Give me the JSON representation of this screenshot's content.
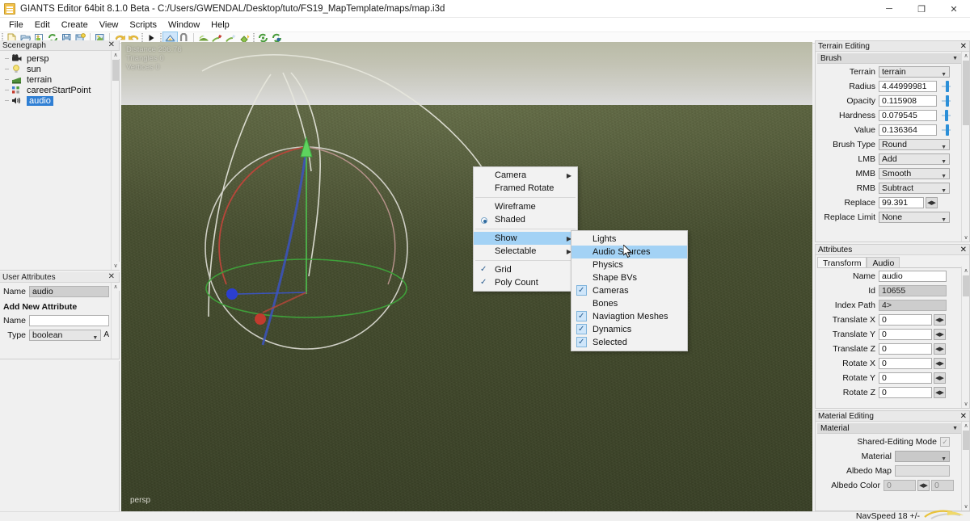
{
  "window": {
    "title": "GIANTS Editor 64bit 8.1.0 Beta - C:/Users/GWENDAL/Desktop/tuto/FS19_MapTemplate/maps/map.i3d",
    "app_icon": "app-icon",
    "minimize": "─",
    "maximize": "❐",
    "close": "✕"
  },
  "menubar": {
    "items": [
      "File",
      "Edit",
      "Create",
      "View",
      "Scripts",
      "Window",
      "Help"
    ]
  },
  "toolbar": {
    "groups": [
      {
        "icons": [
          "new-file-icon",
          "open-file-icon",
          "import-icon",
          "reload-icon",
          "save-icon",
          "save-as-icon"
        ]
      },
      {
        "icons": [
          "undo-history-icon"
        ]
      },
      {
        "icons": [
          "undo-icon",
          "redo-icon"
        ]
      },
      {
        "icons": [
          "play-icon"
        ]
      },
      {
        "icons": [
          "terrain-edit-icon",
          "snap-icon"
        ]
      },
      {
        "icons": [
          "paint-layer-icon",
          "foliage-paint-icon",
          "foliage-erase-icon",
          "foliage-fill-icon"
        ]
      },
      {
        "icons": [
          "refresh-shaders-icon",
          "reload-scene-icon"
        ]
      }
    ]
  },
  "scenegraph": {
    "title": "Scenegraph",
    "close": "✕",
    "items": [
      {
        "label": "persp",
        "icon": "camera-icon",
        "selected": false
      },
      {
        "label": "sun",
        "icon": "light-bulb-icon",
        "selected": false
      },
      {
        "label": "terrain",
        "icon": "terrain-icon",
        "selected": false
      },
      {
        "label": "careerStartPoint",
        "icon": "transform-group-icon",
        "selected": false
      },
      {
        "label": "audio",
        "icon": "audio-source-icon",
        "selected": true
      }
    ],
    "scroll_up": "∧",
    "scroll_down": "∨"
  },
  "user_attributes": {
    "title": "User Attributes",
    "close": "✕",
    "name_label": "Name",
    "name_value": "audio",
    "add_section_title": "Add New Attribute",
    "new_name_label": "Name",
    "new_name_value": "",
    "type_label": "Type",
    "type_value": "boolean",
    "add_button": "A",
    "scroll_up": "∧"
  },
  "viewport": {
    "stats": [
      "Distance 296.76",
      "Triangles 0",
      "Vertices 0"
    ],
    "view_name": "persp",
    "gizmo": {
      "x_axis_color": "#c23b2e",
      "y_axis_color": "#3fc23f",
      "z_axis_color": "#2b3fd0",
      "ring_color": "#d6d6cc"
    }
  },
  "context_menu": {
    "items": [
      {
        "label": "Camera",
        "submenu": true,
        "check": "none"
      },
      {
        "label": "Framed Rotate",
        "submenu": false,
        "check": "none"
      },
      {
        "separator_after": true
      },
      {
        "label": "Wireframe",
        "submenu": false,
        "check": "none"
      },
      {
        "label": "Shaded",
        "submenu": false,
        "check": "radio"
      },
      {
        "separator_after": true
      },
      {
        "label": "Show",
        "submenu": true,
        "check": "none",
        "highlighted": true
      },
      {
        "label": "Selectable",
        "submenu": true,
        "check": "none"
      },
      {
        "separator_after": true
      },
      {
        "label": "Grid",
        "submenu": false,
        "check": "checked"
      },
      {
        "label": "Poly Count",
        "submenu": false,
        "check": "checked"
      }
    ]
  },
  "show_submenu": {
    "items": [
      {
        "label": "Lights",
        "check": "none",
        "highlighted": false
      },
      {
        "label": "Audio Sources",
        "check": "none",
        "highlighted": true
      },
      {
        "label": "Physics",
        "check": "none",
        "highlighted": false
      },
      {
        "label": "Shape BVs",
        "check": "none",
        "highlighted": false
      },
      {
        "label": "Cameras",
        "check": "checked",
        "highlighted": false
      },
      {
        "label": "Bones",
        "check": "none",
        "highlighted": false
      },
      {
        "label": "Naviagtion Meshes",
        "check": "checked",
        "highlighted": false
      },
      {
        "label": "Dynamics",
        "check": "checked",
        "highlighted": false
      },
      {
        "label": "Selected",
        "check": "checked",
        "highlighted": false
      }
    ],
    "check_glyph": "✓"
  },
  "terrain_editing": {
    "title": "Terrain Editing",
    "close": "✕",
    "section": "Brush",
    "section_tri": "▼",
    "rows": [
      {
        "label": "Terrain",
        "value": "terrain",
        "kind": "combo"
      },
      {
        "label": "Radius",
        "value": "4.44999981",
        "kind": "input",
        "slider": 0.72
      },
      {
        "label": "Opacity",
        "value": "0.115908",
        "kind": "input",
        "slider": 0.62
      },
      {
        "label": "Hardness",
        "value": "0.079545",
        "kind": "input",
        "slider": 0.66
      },
      {
        "label": "Value",
        "value": "0.136364",
        "kind": "input",
        "slider": 0.55
      },
      {
        "label": "Brush Type",
        "value": "Round",
        "kind": "combo"
      },
      {
        "label": "LMB",
        "value": "Add",
        "kind": "combo"
      },
      {
        "label": "MMB",
        "value": "Smooth",
        "kind": "combo"
      },
      {
        "label": "RMB",
        "value": "Subtract",
        "kind": "combo"
      },
      {
        "label": "Replace",
        "value": "99.391",
        "kind": "spin"
      },
      {
        "label": "Replace Limit",
        "value": "None",
        "kind": "combo"
      }
    ],
    "scroll_up": "∧",
    "scroll_down": "∨"
  },
  "attributes": {
    "title": "Attributes",
    "close": "✕",
    "tabs": [
      {
        "label": "Transform",
        "active": true
      },
      {
        "label": "Audio",
        "active": false
      }
    ],
    "rows": [
      {
        "label": "Name",
        "value": "audio",
        "kind": "input"
      },
      {
        "label": "Id",
        "value": "10655",
        "kind": "readonly"
      },
      {
        "label": "Index Path",
        "value": "4>",
        "kind": "readonly"
      },
      {
        "label": "Translate X",
        "value": "0",
        "kind": "spin"
      },
      {
        "label": "Translate Y",
        "value": "0",
        "kind": "spin"
      },
      {
        "label": "Translate Z",
        "value": "0",
        "kind": "spin"
      },
      {
        "label": "Rotate X",
        "value": "0",
        "kind": "spin"
      },
      {
        "label": "Rotate Y",
        "value": "0",
        "kind": "spin"
      },
      {
        "label": "Rotate Z",
        "value": "0",
        "kind": "spin"
      }
    ],
    "scroll_up": "∧",
    "scroll_down": "∨"
  },
  "material_editing": {
    "title": "Material Editing",
    "close": "✕",
    "section": "Material",
    "section_tri": "▼",
    "shared_mode_label": "Shared-Editing Mode",
    "shared_mode_checked": true,
    "rows": [
      {
        "label": "Material",
        "value": "",
        "kind": "combo-disabled"
      },
      {
        "label": "Albedo Map",
        "value": "",
        "kind": "readonly"
      },
      {
        "label": "Albedo Color",
        "value": "0",
        "value2": "0",
        "kind": "color"
      }
    ],
    "scroll_up": "∧",
    "scroll_down": "∨"
  },
  "statusbar": {
    "navspeed": "NavSpeed 18 +/-",
    "logo": "giants-logo"
  }
}
